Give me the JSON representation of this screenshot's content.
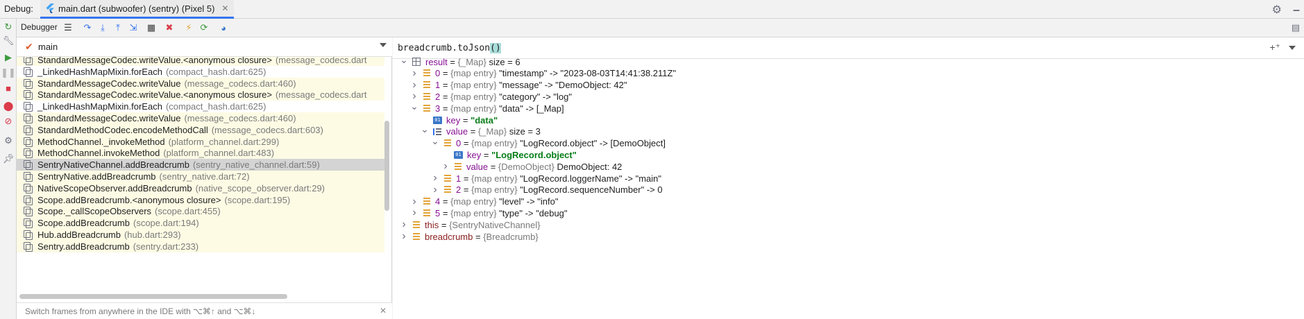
{
  "titlebar": {
    "debug_label": "Debug:",
    "tab_label": "main.dart (subwoofer) (sentry) (Pixel 5)"
  },
  "toolbar": {
    "debugger_tab": "Debugger"
  },
  "frames": {
    "thread": "main",
    "rows": [
      {
        "fn": "StandardMessageCodec.writeValue.<anonymous closure>",
        "loc": "(message_codecs.dart",
        "lib": true
      },
      {
        "fn": "_LinkedHashMapMixin.forEach",
        "loc": "(compact_hash.dart:625)",
        "lib": false
      },
      {
        "fn": "StandardMessageCodec.writeValue",
        "loc": "(message_codecs.dart:460)",
        "lib": true
      },
      {
        "fn": "StandardMessageCodec.writeValue.<anonymous closure>",
        "loc": "(message_codecs.dart",
        "lib": true
      },
      {
        "fn": "_LinkedHashMapMixin.forEach",
        "loc": "(compact_hash.dart:625)",
        "lib": false
      },
      {
        "fn": "StandardMessageCodec.writeValue",
        "loc": "(message_codecs.dart:460)",
        "lib": true
      },
      {
        "fn": "StandardMethodCodec.encodeMethodCall",
        "loc": "(message_codecs.dart:603)",
        "lib": true
      },
      {
        "fn": "MethodChannel._invokeMethod",
        "loc": "(platform_channel.dart:299)",
        "lib": true
      },
      {
        "fn": "MethodChannel.invokeMethod",
        "loc": "(platform_channel.dart:483)",
        "lib": true
      },
      {
        "fn": "SentryNativeChannel.addBreadcrumb",
        "loc": "(sentry_native_channel.dart:59)",
        "lib": false,
        "selected": true
      },
      {
        "fn": "SentryNative.addBreadcrumb",
        "loc": "(sentry_native.dart:72)",
        "lib": true
      },
      {
        "fn": "NativeScopeObserver.addBreadcrumb",
        "loc": "(native_scope_observer.dart:29)",
        "lib": true
      },
      {
        "fn": "Scope.addBreadcrumb.<anonymous closure>",
        "loc": "(scope.dart:195)",
        "lib": true
      },
      {
        "fn": "Scope._callScopeObservers",
        "loc": "(scope.dart:455)",
        "lib": true
      },
      {
        "fn": "Scope.addBreadcrumb",
        "loc": "(scope.dart:194)",
        "lib": true
      },
      {
        "fn": "Hub.addBreadcrumb",
        "loc": "(hub.dart:293)",
        "lib": true
      },
      {
        "fn": "Sentry.addBreadcrumb",
        "loc": "(sentry.dart:233)",
        "lib": true
      }
    ],
    "hint": "Switch frames from anywhere in the IDE with ⌥⌘↑ and ⌥⌘↓"
  },
  "variables": {
    "expression": "breadcrumb.toJson",
    "expression_paren": "()",
    "rows": [
      {
        "indent": 0,
        "arrow": "down",
        "icon": "grid",
        "name": "result",
        "type": "{_Map}",
        "value": "size = 6",
        "valkind": "plain"
      },
      {
        "indent": 1,
        "arrow": "right",
        "icon": "map",
        "name": "0",
        "type": "{map entry}",
        "value": "\"timestamp\" -> \"2023-08-03T14:41:38.211Z\"",
        "valkind": "plain"
      },
      {
        "indent": 1,
        "arrow": "right",
        "icon": "map",
        "name": "1",
        "type": "{map entry}",
        "value": "\"message\" -> \"DemoObject: 42\"",
        "valkind": "plain"
      },
      {
        "indent": 1,
        "arrow": "right",
        "icon": "map",
        "name": "2",
        "type": "{map entry}",
        "value": "\"category\" -> \"log\"",
        "valkind": "plain"
      },
      {
        "indent": 1,
        "arrow": "down",
        "icon": "map",
        "name": "3",
        "type": "{map entry}",
        "value": "\"data\" -> [_Map]",
        "valkind": "plain"
      },
      {
        "indent": 2,
        "arrow": "none",
        "icon": "prim",
        "name": "key",
        "type": "",
        "value": "\"data\"",
        "valkind": "str"
      },
      {
        "indent": 2,
        "arrow": "down",
        "icon": "list",
        "name": "value",
        "type": "{_Map}",
        "value": "size = 3",
        "valkind": "plain"
      },
      {
        "indent": 3,
        "arrow": "down",
        "icon": "map",
        "name": "0",
        "type": "{map entry}",
        "value": "\"LogRecord.object\" -> [DemoObject]",
        "valkind": "plain"
      },
      {
        "indent": 4,
        "arrow": "none",
        "icon": "prim",
        "name": "key",
        "type": "",
        "value": "\"LogRecord.object\"",
        "valkind": "str"
      },
      {
        "indent": 4,
        "arrow": "right",
        "icon": "map",
        "name": "value",
        "type": "{DemoObject}",
        "value": "DemoObject: 42",
        "valkind": "plain"
      },
      {
        "indent": 3,
        "arrow": "right",
        "icon": "map",
        "name": "1",
        "type": "{map entry}",
        "value": "\"LogRecord.loggerName\" -> \"main\"",
        "valkind": "plain"
      },
      {
        "indent": 3,
        "arrow": "right",
        "icon": "map",
        "name": "2",
        "type": "{map entry}",
        "value": "\"LogRecord.sequenceNumber\" -> 0",
        "valkind": "plain"
      },
      {
        "indent": 1,
        "arrow": "right",
        "icon": "map",
        "name": "4",
        "type": "{map entry}",
        "value": "\"level\" -> \"info\"",
        "valkind": "plain"
      },
      {
        "indent": 1,
        "arrow": "right",
        "icon": "map",
        "name": "5",
        "type": "{map entry}",
        "value": "\"type\" -> \"debug\"",
        "valkind": "plain"
      },
      {
        "indent": 0,
        "arrow": "right",
        "icon": "map",
        "name": "this",
        "type": "{SentryNativeChannel}",
        "value": "",
        "valkind": "plain",
        "dark": true
      },
      {
        "indent": 0,
        "arrow": "right",
        "icon": "map",
        "name": "breadcrumb",
        "type": "{Breadcrumb}",
        "value": "",
        "valkind": "plain",
        "dark": true
      }
    ]
  },
  "colors": {
    "accent": "#3574f0",
    "library_frame_bg": "#fdfbe4",
    "selected_frame_bg": "#d4d4d4",
    "string_value": "#067d17",
    "variable_name": "#871094"
  }
}
